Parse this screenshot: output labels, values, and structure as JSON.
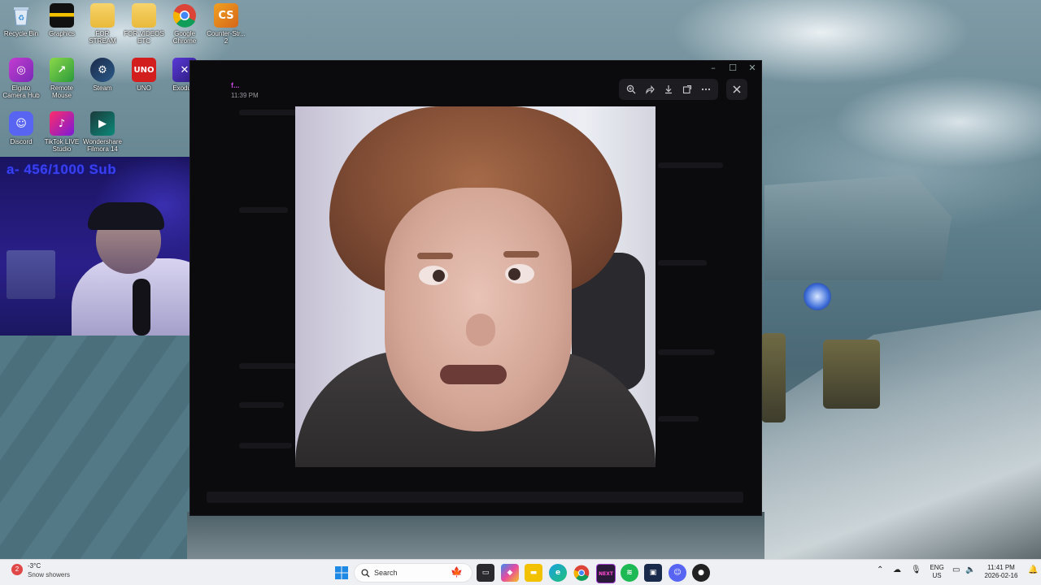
{
  "desktop": {
    "icons": [
      {
        "label": "Recycle Bin",
        "icon": "recycle-bin-icon"
      },
      {
        "label": "Graphics",
        "icon": "folder-dark-icon"
      },
      {
        "label": "FOR STREAM",
        "icon": "folder-icon"
      },
      {
        "label": "FOR VIDEOS ETC",
        "icon": "folder-icon"
      },
      {
        "label": "Google Chrome",
        "icon": "chrome-icon"
      },
      {
        "label": "Counter-Str... 2",
        "icon": "counter-strike-icon"
      },
      {
        "label": "Elgato Camera Hub",
        "icon": "elgato-icon"
      },
      {
        "label": "Remote Mouse",
        "icon": "remote-mouse-icon"
      },
      {
        "label": "Steam",
        "icon": "steam-icon"
      },
      {
        "label": "UNO",
        "icon": "uno-icon"
      },
      {
        "label": "Exodu...",
        "icon": "exodus-icon"
      },
      {
        "label": "Discord",
        "icon": "discord-icon"
      },
      {
        "label": "TikTok LIVE Studio",
        "icon": "tiktok-icon"
      },
      {
        "label": "Wondershare Filmora 14",
        "icon": "filmora-icon"
      }
    ]
  },
  "webcam": {
    "sub_goal": "a- 456/1000 Sub"
  },
  "viewer": {
    "author": "f...",
    "time": "11:39 PM",
    "toolbar": [
      "zoom-in-icon",
      "forward-icon",
      "download-icon",
      "open-external-icon",
      "more-icon"
    ],
    "close": "close-icon"
  },
  "taskbar": {
    "weather": {
      "temp": "-3°C",
      "desc": "Snow showers",
      "alert": "2"
    },
    "search_placeholder": "Search",
    "apps": [
      "windows-start-icon",
      "canada-flag-icon",
      "file-explorer-icon",
      "copilot-icon",
      "folder-icon",
      "edge-icon",
      "chrome-icon",
      "next-icon",
      "spotify-icon",
      "app-icon",
      "discord-icon",
      "app-icon"
    ],
    "tray": {
      "lang_top": "ENG",
      "lang_bottom": "US",
      "time": "11:41 PM",
      "date": "2026-02-16"
    }
  },
  "colors": {
    "taskbar_bg": "#eef0f3",
    "webcam_text": "#3b3ff0",
    "author": "#c04ad8"
  }
}
